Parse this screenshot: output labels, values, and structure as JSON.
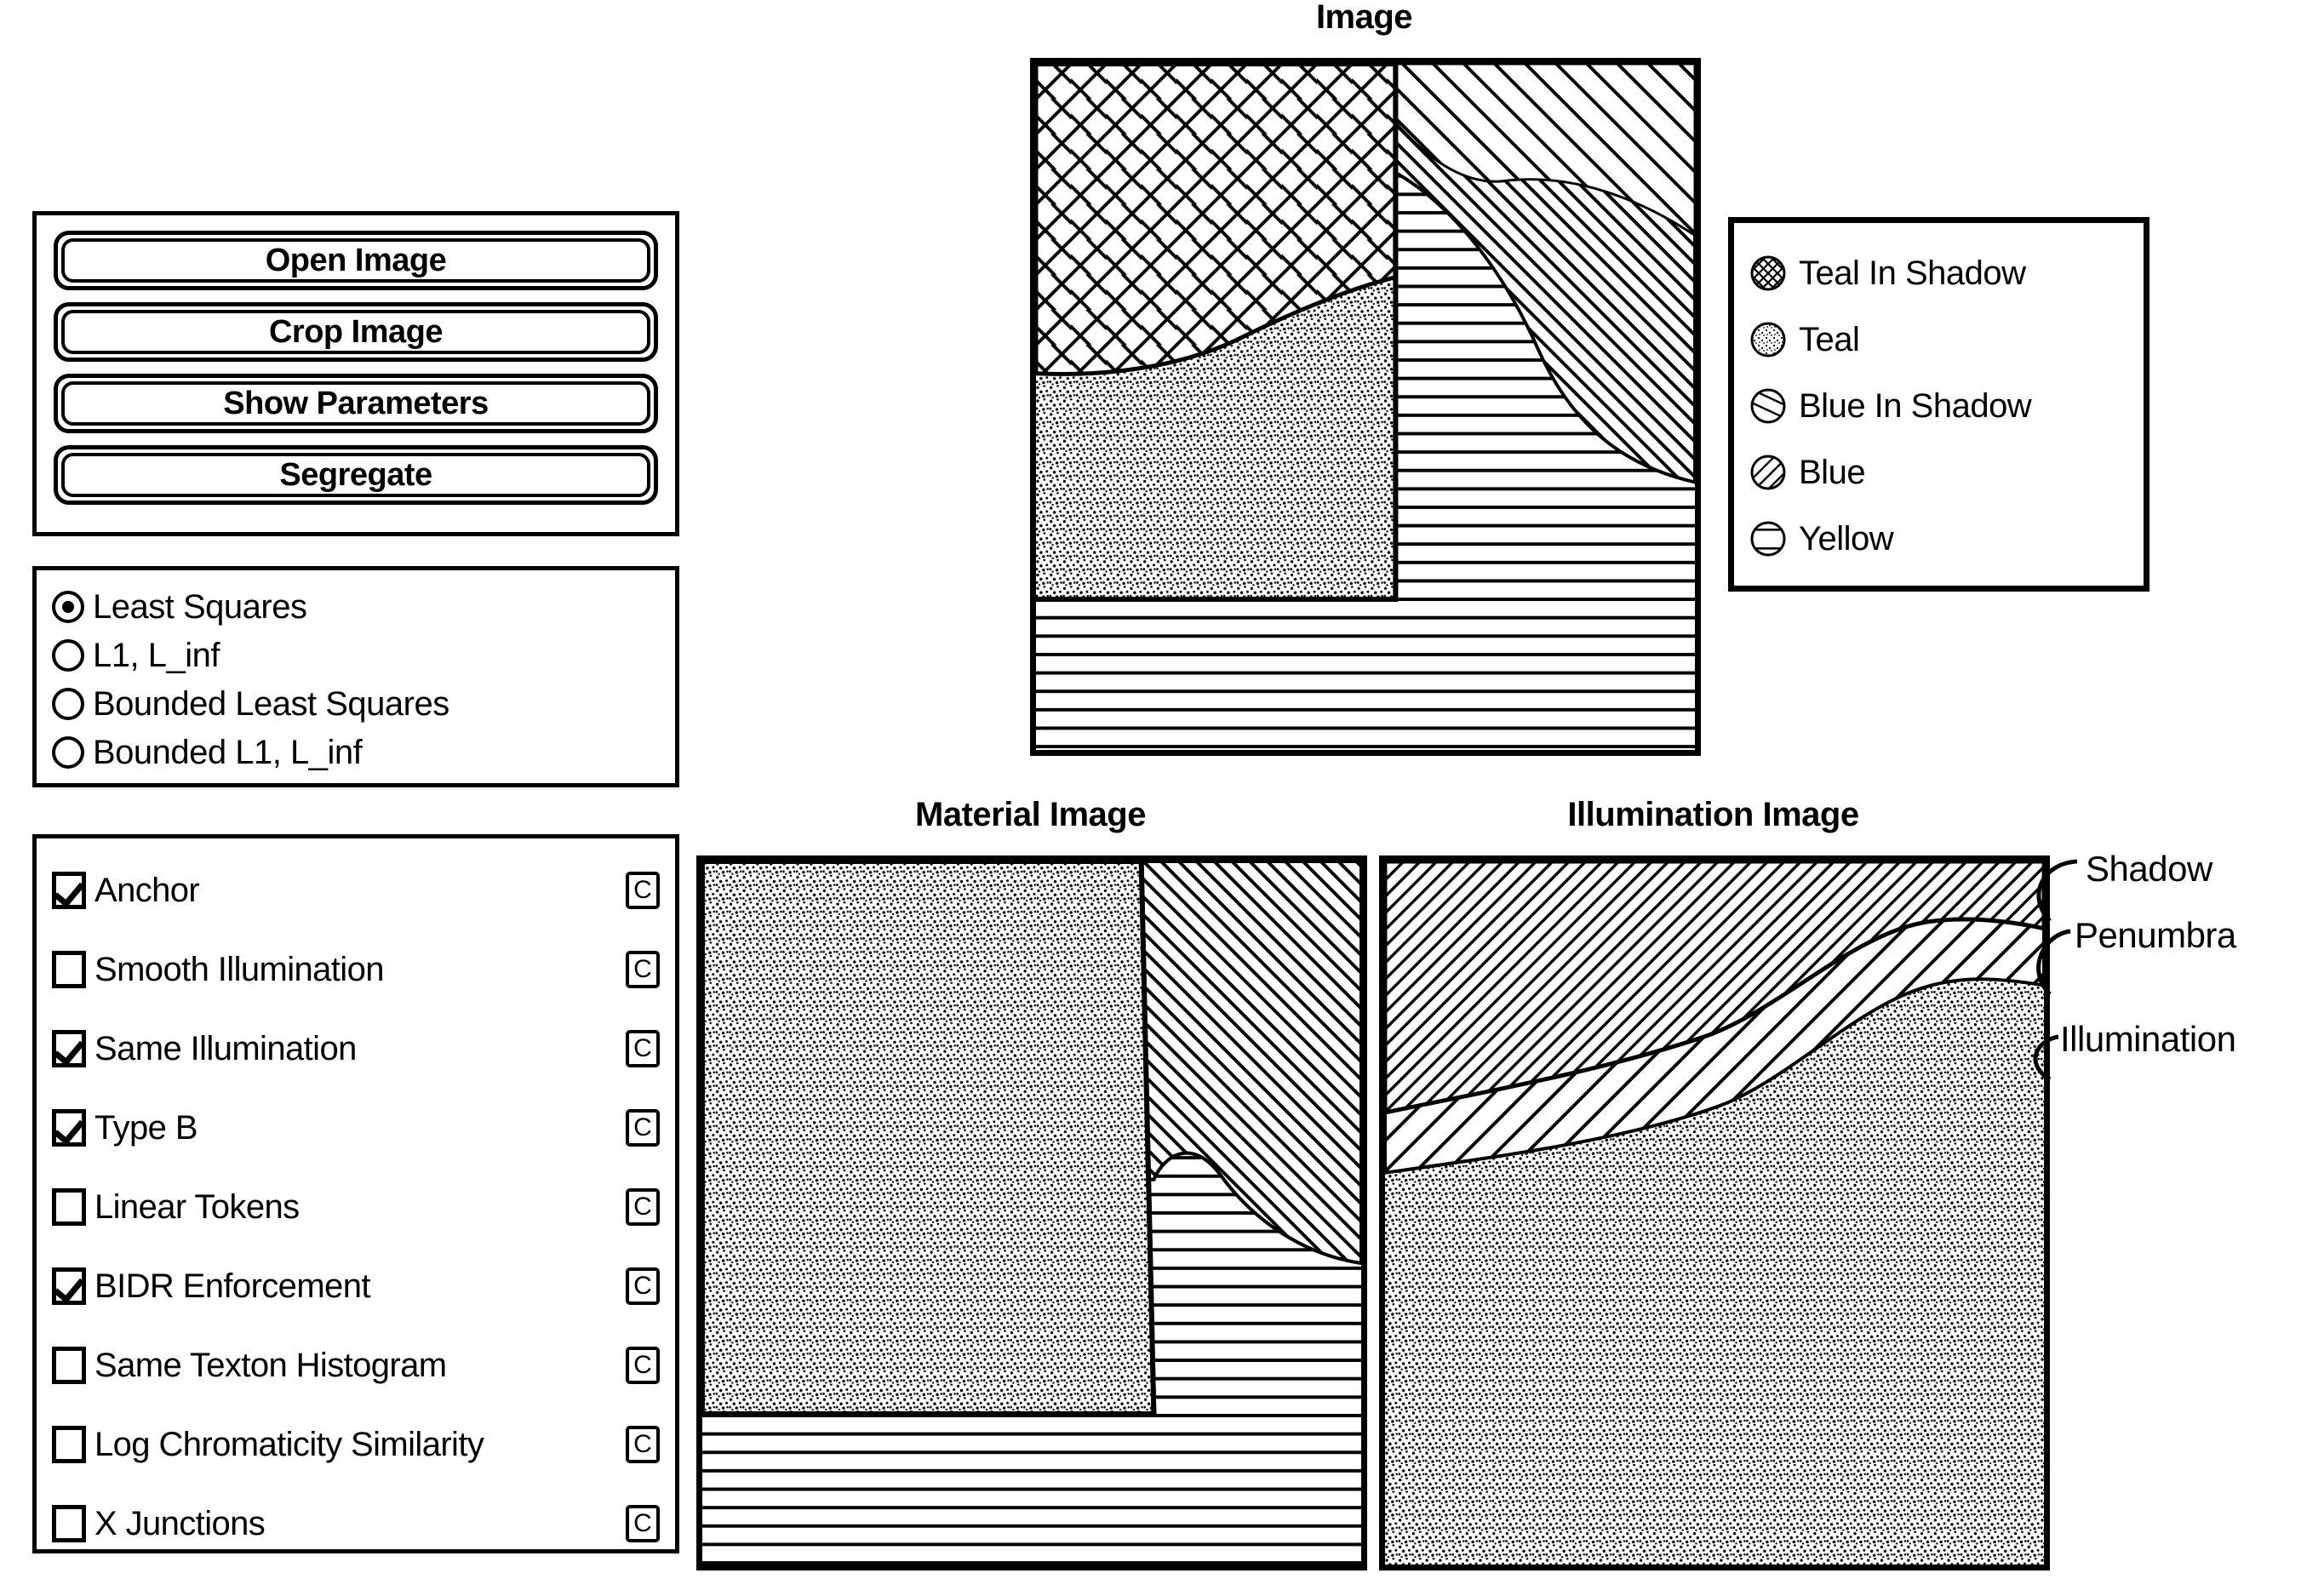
{
  "buttons": {
    "items": [
      {
        "label": "Open Image",
        "name": "open-image-button"
      },
      {
        "label": "Crop Image",
        "name": "crop-image-button"
      },
      {
        "label": "Show Parameters",
        "name": "show-parameters-button"
      },
      {
        "label": "Segregate",
        "name": "segregate-button"
      }
    ]
  },
  "solver_options": {
    "selected": "Least Squares",
    "items": [
      {
        "label": "Least Squares",
        "checked": true
      },
      {
        "label": "L1, L_inf",
        "checked": false
      },
      {
        "label": "Bounded Least Squares",
        "checked": false
      },
      {
        "label": "Bounded L1, L_inf",
        "checked": false
      }
    ]
  },
  "constraints": {
    "badge_label": "C",
    "items": [
      {
        "label": "Anchor",
        "checked": true
      },
      {
        "label": "Smooth Illumination",
        "checked": false
      },
      {
        "label": "Same Illumination",
        "checked": true
      },
      {
        "label": "Type B",
        "checked": true
      },
      {
        "label": "Linear Tokens",
        "checked": false
      },
      {
        "label": "BIDR Enforcement",
        "checked": true
      },
      {
        "label": "Same Texton Histogram",
        "checked": false
      },
      {
        "label": "Log Chromaticity Similarity",
        "checked": false
      },
      {
        "label": "X Junctions",
        "checked": false
      }
    ]
  },
  "panels": {
    "image_title": "Image",
    "material_title": "Material Image",
    "illumination_title": "Illumination Image"
  },
  "legend": {
    "items": [
      {
        "label": "Teal In Shadow",
        "pattern": "crosshatch-circle-icon"
      },
      {
        "label": "Teal",
        "pattern": "stipple-circle-icon"
      },
      {
        "label": "Blue In Shadow",
        "pattern": "sparse-diagonal-circle-icon"
      },
      {
        "label": "Blue",
        "pattern": "dense-diagonal-circle-icon"
      },
      {
        "label": "Yellow",
        "pattern": "horizontal-line-circle-icon"
      }
    ]
  },
  "callouts": {
    "shadow": "Shadow",
    "penumbra": "Penumbra",
    "illumination": "Illumination"
  },
  "colors": {
    "ink": "#000000",
    "paper": "#ffffff"
  }
}
